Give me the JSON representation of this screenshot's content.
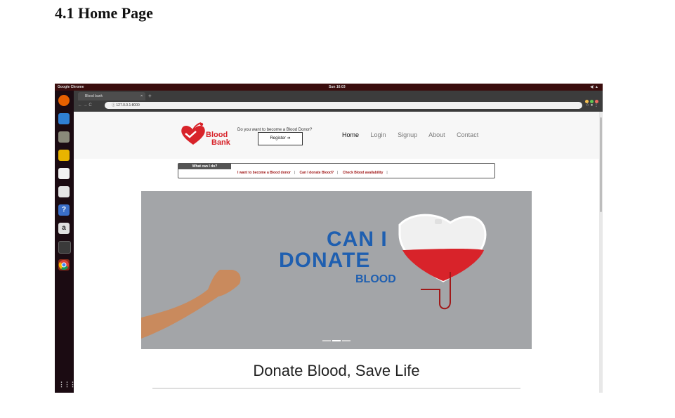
{
  "document": {
    "heading": "4.1 Home Page"
  },
  "os": {
    "app_name": "Google Chrome",
    "clock": "Sun 16:03",
    "tray": "◀) ▲",
    "launcher_icons": [
      "firefox-icon",
      "thunderbird-icon",
      "files-icon",
      "rhythmbox-icon",
      "writer-icon",
      "software-center-icon",
      "help-icon",
      "amazon-icon",
      "terminal-icon",
      "chrome-icon"
    ],
    "apps_grid_icon": "⋮⋮⋮"
  },
  "browser": {
    "tab_title": "Blood bank",
    "tab_close": "×",
    "new_tab": "+",
    "nav_buttons": "←  →  C",
    "url": "ⓘ 127.0.0.1:8000",
    "right_icons": "☆ ● ⋮",
    "window_dots": [
      "#f4bf4f",
      "#61c554",
      "#ed6a5e"
    ]
  },
  "site": {
    "logo_line1": "Blood",
    "logo_line2": "Bank",
    "question": "Do you want to become a Blood Donor?",
    "register_label": "Register",
    "register_arrow": "➔",
    "nav": [
      "Home",
      "Login",
      "Signup",
      "About",
      "Contact"
    ],
    "quick_label": "What can I do?",
    "quick_links": [
      "I want to become a Blood donor",
      "Can I donate Blood?",
      "Check Blood availability"
    ],
    "banner": {
      "line1": "CAN I",
      "line2": "DONATE",
      "line3": "BLOOD"
    },
    "tagline": "Donate Blood, Save Life",
    "colors": {
      "brand_red": "#d8232a",
      "banner_blue": "#1f5fb0"
    }
  }
}
